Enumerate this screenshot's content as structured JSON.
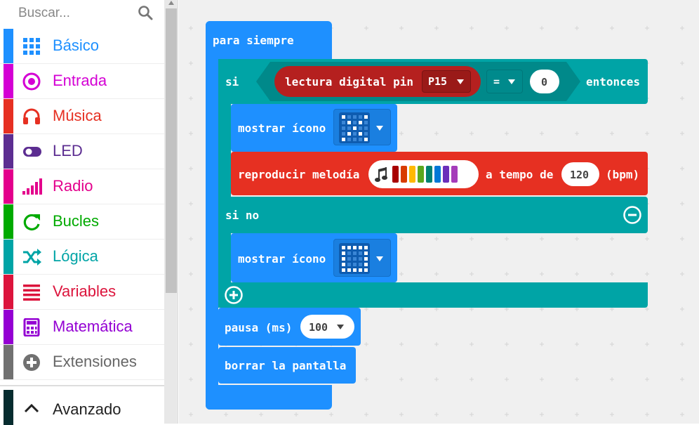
{
  "search": {
    "placeholder": "Buscar..."
  },
  "categories": [
    {
      "label": "Básico",
      "color": "#1e90ff",
      "icon": "grid-icon"
    },
    {
      "label": "Entrada",
      "color": "#d400d4",
      "icon": "radio-button-icon"
    },
    {
      "label": "Música",
      "color": "#e63022",
      "icon": "headphones-icon"
    },
    {
      "label": "LED",
      "color": "#5c2d91",
      "icon": "toggle-icon"
    },
    {
      "label": "Radio",
      "color": "#e3008c",
      "icon": "signal-bars-icon"
    },
    {
      "label": "Bucles",
      "color": "#00aa00",
      "icon": "refresh-icon"
    },
    {
      "label": "Lógica",
      "color": "#00a4a6",
      "icon": "shuffle-icon"
    },
    {
      "label": "Variables",
      "color": "#dc143c",
      "icon": "lines-icon"
    },
    {
      "label": "Matemática",
      "color": "#9400d3",
      "icon": "calculator-icon"
    },
    {
      "label": "Extensiones",
      "color": "#717171",
      "icon": "plus-circle-icon"
    }
  ],
  "advanced": {
    "label": "Avanzado",
    "icon": "chevron-up-icon"
  },
  "blocks": {
    "forever": "para siempre",
    "if_label": "si",
    "digital_read": "lectura digital pin",
    "pin": "P15",
    "operator": "=",
    "compare_value": "0",
    "then_label": "entonces",
    "show_icon_1": "mostrar ícono",
    "play_melody": "reproducir melodía",
    "tempo_label": "a tempo de",
    "tempo_value": "120",
    "bpm_label": "(bpm)",
    "else_label": "si no",
    "show_icon_2": "mostrar ícono",
    "pause_label": "pausa (ms)",
    "pause_value": "100",
    "clear_screen": "borrar la pantalla"
  },
  "colors": {
    "basic": "#1e90ff",
    "logic": "#00a4a6",
    "input": "#b5201f",
    "music": "#e63022"
  }
}
